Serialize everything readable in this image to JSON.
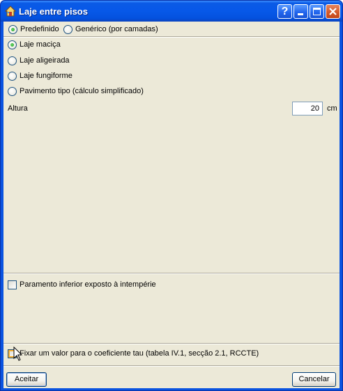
{
  "window": {
    "title": "Laje entre pisos",
    "help_label": "?"
  },
  "mode": {
    "options": [
      "Predefinido",
      "Genérico (por camadas)"
    ],
    "selected": "Predefinido"
  },
  "slab_type": {
    "options": [
      "Laje maciça",
      "Laje aligeirada",
      "Laje fungiforme",
      "Pavimento tipo (cálculo simplificado)"
    ],
    "selected": "Laje maciça"
  },
  "height": {
    "label": "Altura",
    "value": "20",
    "unit": "cm"
  },
  "exposed": {
    "label": "Paramento inferior exposto à intempérie",
    "checked": false
  },
  "tau": {
    "label": "Fixar um valor para o coeficiente tau (tabela IV.1, secção 2.1, RCCTE)",
    "checked": false
  },
  "buttons": {
    "ok": "Aceitar",
    "cancel": "Cancelar"
  },
  "icons": {
    "app": "house-icon",
    "cursor": "mouse-pointer-icon"
  },
  "colors": {
    "titlebar": "#0758e8",
    "dialog_bg": "#ece9d8",
    "close_button": "#d45a2b"
  }
}
